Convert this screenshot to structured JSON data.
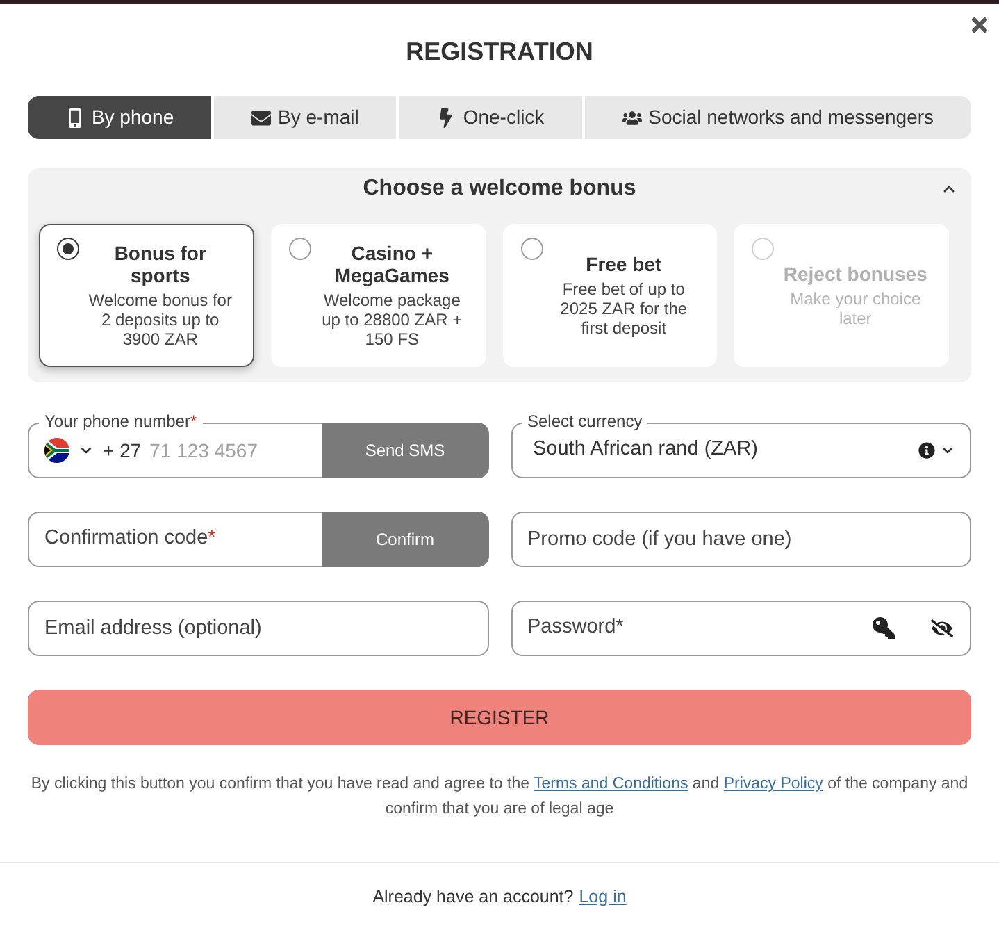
{
  "dialog": {
    "title": "REGISTRATION"
  },
  "tabs": [
    {
      "kind": "phone",
      "label": "By phone",
      "selected": true
    },
    {
      "kind": "email",
      "label": "By e-mail",
      "selected": false
    },
    {
      "kind": "one-click",
      "label": "One-click",
      "selected": false
    },
    {
      "kind": "social",
      "label": "Social networks and messengers",
      "selected": false
    }
  ],
  "bonus": {
    "title": "Choose a welcome bonus",
    "expanded": true,
    "options": [
      {
        "title": "Bonus for sports",
        "description": "Welcome bonus for 2 deposits up to 3900 ZAR",
        "selected": true,
        "disabled": false
      },
      {
        "title": "Casino + MegaGames",
        "description": "Welcome package up to 28800 ZAR + 150 FS",
        "selected": false,
        "disabled": false
      },
      {
        "title": "Free bet",
        "description": "Free bet of up to 2025 ZAR for the first deposit",
        "selected": false,
        "disabled": false
      },
      {
        "title": "Reject bonuses",
        "description": "Make your choice later",
        "selected": false,
        "disabled": true
      }
    ]
  },
  "form": {
    "phone": {
      "label": "Your phone number",
      "required_mark": "*",
      "country_code": "+ 27",
      "placeholder": "71 123 4567",
      "button": "Send SMS"
    },
    "currency": {
      "label": "Select currency",
      "value": "South African rand (ZAR)"
    },
    "confirmation": {
      "placeholder": "Confirmation code",
      "required_mark": "*",
      "button": "Confirm"
    },
    "promo": {
      "placeholder": "Promo code (if you have one)"
    },
    "email": {
      "placeholder": "Email address (optional)"
    },
    "password": {
      "placeholder": "Password*"
    }
  },
  "register": {
    "label": "REGISTER"
  },
  "agreement": [
    {
      "kind": "text",
      "text": "By clicking this button you confirm that you have read and agree to the "
    },
    {
      "kind": "link",
      "text": "Terms and Conditions"
    },
    {
      "kind": "text",
      "text": " and "
    },
    {
      "kind": "link",
      "text": "Privacy Policy"
    },
    {
      "kind": "text",
      "text": " of the company and confirm that you are of legal age"
    }
  ],
  "footer": {
    "text": "Already have an account?",
    "link": "Log in"
  }
}
